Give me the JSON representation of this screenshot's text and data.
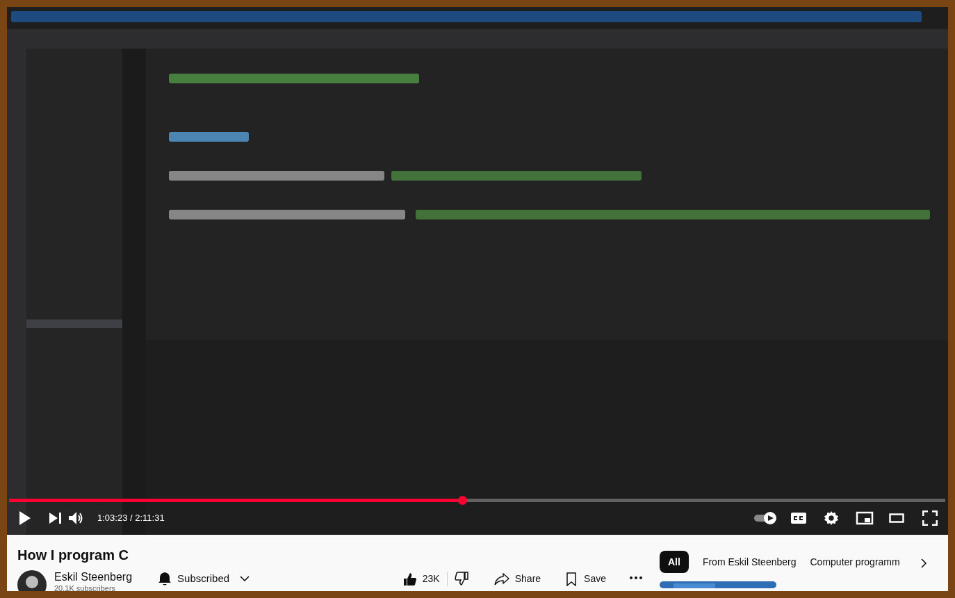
{
  "player": {
    "progress": {
      "level": 0.484
    },
    "time": "1:03:23 / 2:11:31"
  },
  "video_title": "How I program C",
  "channel": {
    "name": "Eskil Steenberg",
    "subscribers": "20.1K subscribers",
    "subscribe_label": "Subscribed"
  },
  "actions": {
    "likes": "23K",
    "share": "Share",
    "save": "Save"
  },
  "chips": [
    {
      "label": "All",
      "selected": true
    },
    {
      "label": "From Eskil Steenberg",
      "selected": false
    },
    {
      "label": "Computer programm",
      "selected": false
    }
  ]
}
